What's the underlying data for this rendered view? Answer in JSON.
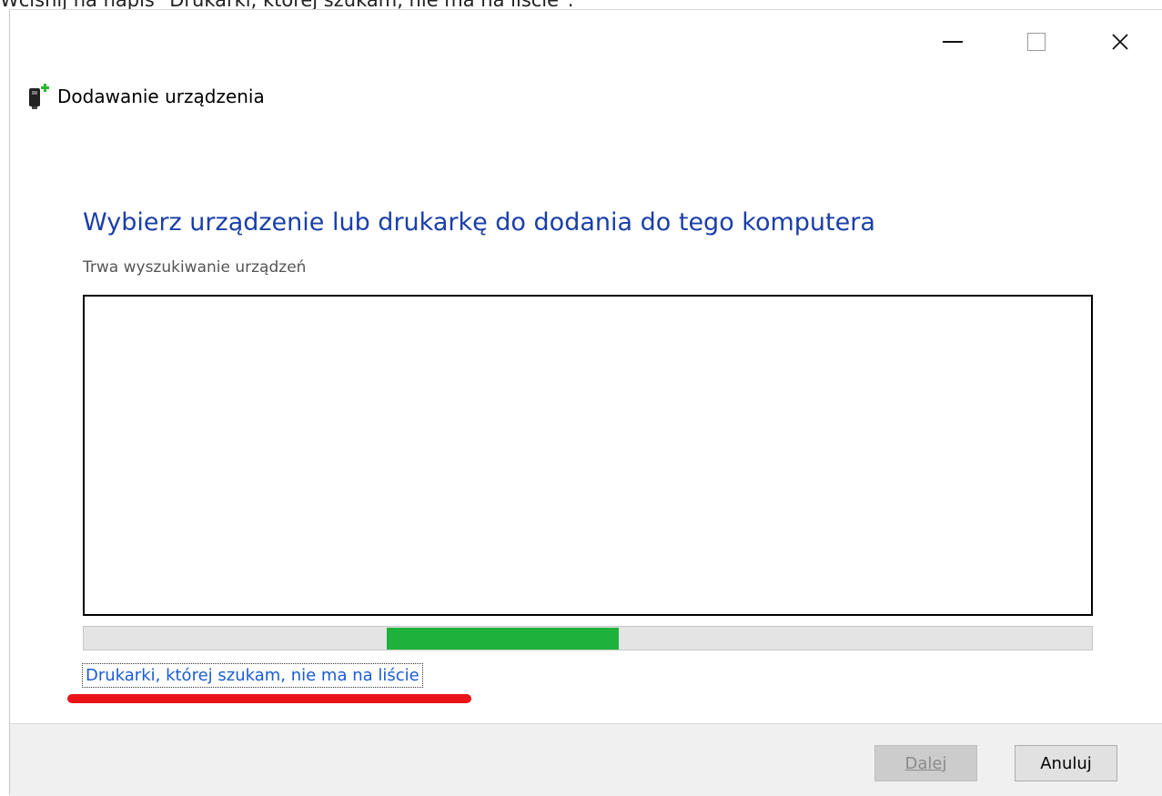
{
  "caption": {
    "text": "Wciśnij na napis \"Drukarki, której szukam, nie ma na liście\"."
  },
  "window": {
    "title": "Dodawanie urządzenia",
    "controls": {
      "minimize": "minimize-icon",
      "maximize": "maximize-icon",
      "close": "close-icon"
    },
    "heading": "Wybierz urządzenie lub drukarkę do dodania do tego komputera",
    "subheading": "Trwa wyszukiwanie urządzeń",
    "device_list": [],
    "progress": {
      "indeterminate": true,
      "color": "#1eb23c"
    },
    "link": "Drukarki, której szukam, nie ma na liście",
    "annotation_color": "#e8141a",
    "buttons": {
      "next": "Dalej",
      "cancel": "Anuluj"
    }
  }
}
